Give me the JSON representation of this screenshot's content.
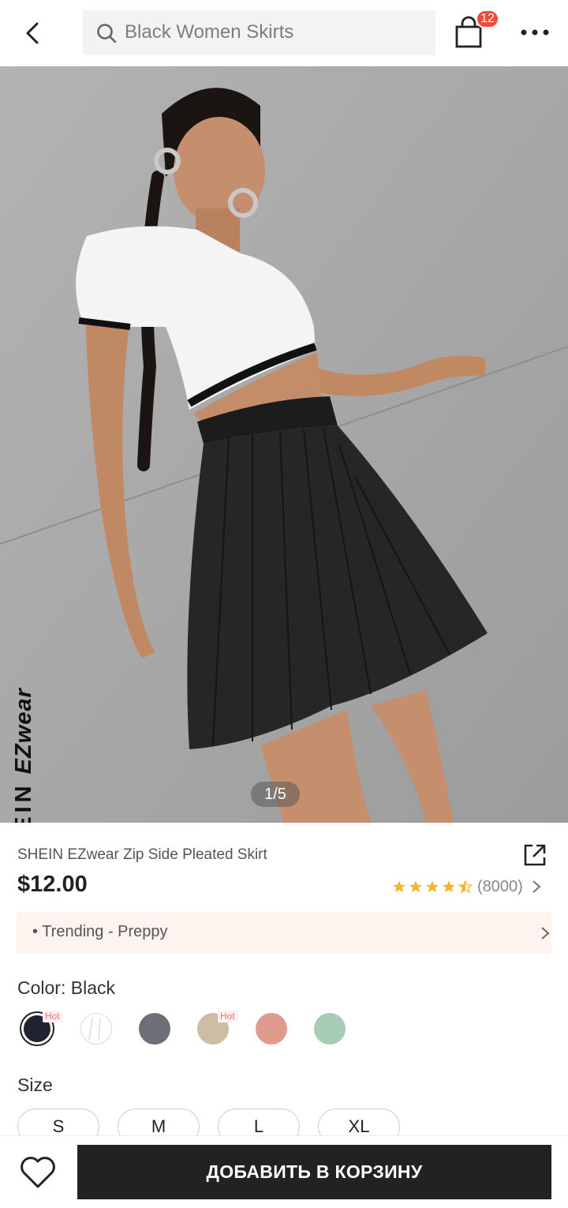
{
  "header": {
    "search_text": "Black Women Skirts",
    "cart_count": "12"
  },
  "gallery": {
    "brand_main": "SHEIN",
    "brand_sub": "EZwear",
    "pager": "1/5"
  },
  "product": {
    "title": "SHEIN EZwear Zip Side Pleated Skirt",
    "price": "$12.00",
    "rating": 4.5,
    "review_count": "(8000)",
    "trend_text": "• Trending - Preppy"
  },
  "color": {
    "label": "Color: Black",
    "swatches": [
      {
        "name": "black",
        "color": "#1f2430",
        "selected": true,
        "hot": "Hot"
      },
      {
        "name": "white",
        "color": "#ffffff",
        "hot": ""
      },
      {
        "name": "grey",
        "color": "#6c6f78",
        "hot": ""
      },
      {
        "name": "khaki",
        "color": "#cdbda5",
        "hot": "Hot"
      },
      {
        "name": "pink",
        "color": "#e09a8e",
        "hot": ""
      },
      {
        "name": "mint",
        "color": "#a5cdb6",
        "hot": ""
      }
    ]
  },
  "size": {
    "label": "Size",
    "options": [
      "S",
      "M",
      "L",
      "XL"
    ]
  },
  "footer": {
    "add_to_cart": "ДОБАВИТЬ В КОРЗИНУ"
  },
  "colors": {
    "accent_red": "#f24b3d",
    "star": "#f6b526",
    "button_dark": "#222222"
  }
}
